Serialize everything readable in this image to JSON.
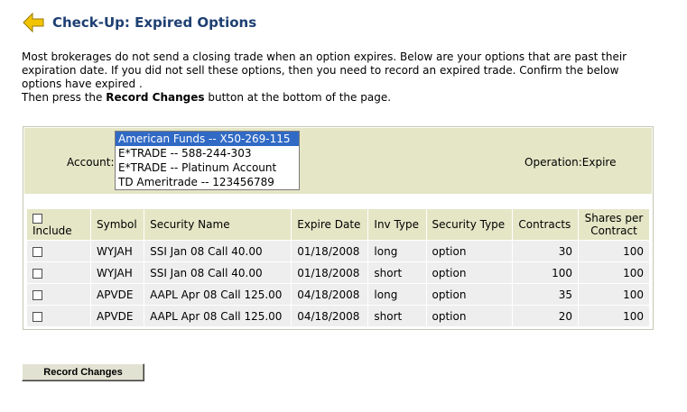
{
  "page": {
    "title": "Check-Up: Expired Options",
    "intro_line1": "Most brokerages do not send a closing trade when an option expires. Below are your options that are past their expiration date. If you did not sell these options, then you need to record an expired trade. Confirm the below options have expired .",
    "intro_line2_prefix": "Then press the ",
    "intro_line2_bold": "Record Changes",
    "intro_line2_suffix": " button at the bottom of the page."
  },
  "account": {
    "label": "Account:",
    "options": [
      "American Funds -- X50-269-115",
      "E*TRADE -- 588-244-303",
      "E*TRADE -- Platinum Account",
      "TD Ameritrade -- 123456789"
    ],
    "selected_index": 0
  },
  "operation": {
    "label": "Operation:",
    "value": "Expire"
  },
  "table": {
    "headers": {
      "include": "Include",
      "symbol": "Symbol",
      "security_name": "Security Name",
      "expire_date": "Expire Date",
      "inv_type": "Inv Type",
      "security_type": "Security Type",
      "contracts": "Contracts",
      "shares_per_contract": "Shares per Contract"
    },
    "rows": [
      {
        "symbol": "WYJAH",
        "security_name": "SSI Jan 08 Call 40.00",
        "expire_date": "01/18/2008",
        "inv_type": "long",
        "security_type": "option",
        "contracts": "30",
        "shares_per_contract": "100"
      },
      {
        "symbol": "WYJAH",
        "security_name": "SSI Jan 08 Call 40.00",
        "expire_date": "01/18/2008",
        "inv_type": "short",
        "security_type": "option",
        "contracts": "100",
        "shares_per_contract": "100"
      },
      {
        "symbol": "APVDE",
        "security_name": "AAPL Apr 08 Call 125.00",
        "expire_date": "04/18/2008",
        "inv_type": "long",
        "security_type": "option",
        "contracts": "35",
        "shares_per_contract": "100"
      },
      {
        "symbol": "APVDE",
        "security_name": "AAPL Apr 08 Call 125.00",
        "expire_date": "04/18/2008",
        "inv_type": "short",
        "security_type": "option",
        "contracts": "20",
        "shares_per_contract": "100"
      }
    ]
  },
  "buttons": {
    "record_changes": "Record Changes"
  },
  "icons": {
    "back": "back-arrow-icon"
  },
  "colors": {
    "title": "#1e3f73",
    "band": "#e4e6c6",
    "row": "#eeeeee",
    "arrow": "#f2c400"
  }
}
